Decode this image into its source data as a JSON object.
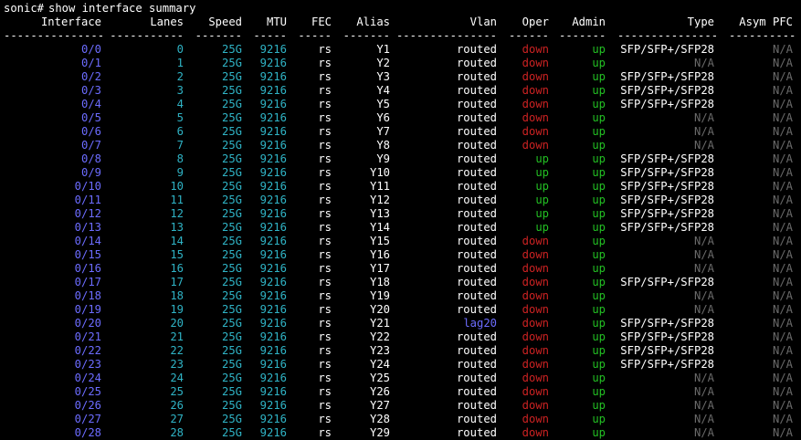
{
  "terminal": {
    "top_line": "---------",
    "prompt": "sonic#",
    "command": "show interface summary"
  },
  "table": {
    "headers": [
      "Interface",
      "Lanes",
      "Speed",
      "MTU",
      "FEC",
      "Alias",
      "Vlan",
      "Oper",
      "Admin",
      "Type",
      "Asym PFC"
    ],
    "dashes": [
      "---------------",
      "-----------",
      "-------",
      "-----",
      "-----",
      "-------",
      "---------------",
      "------",
      "-------",
      "---------------",
      "----------"
    ],
    "rows": [
      {
        "iface": "0/0",
        "lanes": "0",
        "speed": "25G",
        "mtu": "9216",
        "fec": "rs",
        "alias": "Y1",
        "vlan": "routed",
        "oper": "down",
        "admin": "up",
        "type": "SFP/SFP+/SFP28",
        "pfc": "N/A"
      },
      {
        "iface": "0/1",
        "lanes": "1",
        "speed": "25G",
        "mtu": "9216",
        "fec": "rs",
        "alias": "Y2",
        "vlan": "routed",
        "oper": "down",
        "admin": "up",
        "type": "N/A",
        "pfc": "N/A"
      },
      {
        "iface": "0/2",
        "lanes": "2",
        "speed": "25G",
        "mtu": "9216",
        "fec": "rs",
        "alias": "Y3",
        "vlan": "routed",
        "oper": "down",
        "admin": "up",
        "type": "SFP/SFP+/SFP28",
        "pfc": "N/A"
      },
      {
        "iface": "0/3",
        "lanes": "3",
        "speed": "25G",
        "mtu": "9216",
        "fec": "rs",
        "alias": "Y4",
        "vlan": "routed",
        "oper": "down",
        "admin": "up",
        "type": "SFP/SFP+/SFP28",
        "pfc": "N/A"
      },
      {
        "iface": "0/4",
        "lanes": "4",
        "speed": "25G",
        "mtu": "9216",
        "fec": "rs",
        "alias": "Y5",
        "vlan": "routed",
        "oper": "down",
        "admin": "up",
        "type": "SFP/SFP+/SFP28",
        "pfc": "N/A"
      },
      {
        "iface": "0/5",
        "lanes": "5",
        "speed": "25G",
        "mtu": "9216",
        "fec": "rs",
        "alias": "Y6",
        "vlan": "routed",
        "oper": "down",
        "admin": "up",
        "type": "N/A",
        "pfc": "N/A"
      },
      {
        "iface": "0/6",
        "lanes": "6",
        "speed": "25G",
        "mtu": "9216",
        "fec": "rs",
        "alias": "Y7",
        "vlan": "routed",
        "oper": "down",
        "admin": "up",
        "type": "N/A",
        "pfc": "N/A"
      },
      {
        "iface": "0/7",
        "lanes": "7",
        "speed": "25G",
        "mtu": "9216",
        "fec": "rs",
        "alias": "Y8",
        "vlan": "routed",
        "oper": "down",
        "admin": "up",
        "type": "N/A",
        "pfc": "N/A"
      },
      {
        "iface": "0/8",
        "lanes": "8",
        "speed": "25G",
        "mtu": "9216",
        "fec": "rs",
        "alias": "Y9",
        "vlan": "routed",
        "oper": "up",
        "admin": "up",
        "type": "SFP/SFP+/SFP28",
        "pfc": "N/A"
      },
      {
        "iface": "0/9",
        "lanes": "9",
        "speed": "25G",
        "mtu": "9216",
        "fec": "rs",
        "alias": "Y10",
        "vlan": "routed",
        "oper": "up",
        "admin": "up",
        "type": "SFP/SFP+/SFP28",
        "pfc": "N/A"
      },
      {
        "iface": "0/10",
        "lanes": "10",
        "speed": "25G",
        "mtu": "9216",
        "fec": "rs",
        "alias": "Y11",
        "vlan": "routed",
        "oper": "up",
        "admin": "up",
        "type": "SFP/SFP+/SFP28",
        "pfc": "N/A"
      },
      {
        "iface": "0/11",
        "lanes": "11",
        "speed": "25G",
        "mtu": "9216",
        "fec": "rs",
        "alias": "Y12",
        "vlan": "routed",
        "oper": "up",
        "admin": "up",
        "type": "SFP/SFP+/SFP28",
        "pfc": "N/A"
      },
      {
        "iface": "0/12",
        "lanes": "12",
        "speed": "25G",
        "mtu": "9216",
        "fec": "rs",
        "alias": "Y13",
        "vlan": "routed",
        "oper": "up",
        "admin": "up",
        "type": "SFP/SFP+/SFP28",
        "pfc": "N/A"
      },
      {
        "iface": "0/13",
        "lanes": "13",
        "speed": "25G",
        "mtu": "9216",
        "fec": "rs",
        "alias": "Y14",
        "vlan": "routed",
        "oper": "up",
        "admin": "up",
        "type": "SFP/SFP+/SFP28",
        "pfc": "N/A"
      },
      {
        "iface": "0/14",
        "lanes": "14",
        "speed": "25G",
        "mtu": "9216",
        "fec": "rs",
        "alias": "Y15",
        "vlan": "routed",
        "oper": "down",
        "admin": "up",
        "type": "N/A",
        "pfc": "N/A"
      },
      {
        "iface": "0/15",
        "lanes": "15",
        "speed": "25G",
        "mtu": "9216",
        "fec": "rs",
        "alias": "Y16",
        "vlan": "routed",
        "oper": "down",
        "admin": "up",
        "type": "N/A",
        "pfc": "N/A"
      },
      {
        "iface": "0/16",
        "lanes": "16",
        "speed": "25G",
        "mtu": "9216",
        "fec": "rs",
        "alias": "Y17",
        "vlan": "routed",
        "oper": "down",
        "admin": "up",
        "type": "N/A",
        "pfc": "N/A"
      },
      {
        "iface": "0/17",
        "lanes": "17",
        "speed": "25G",
        "mtu": "9216",
        "fec": "rs",
        "alias": "Y18",
        "vlan": "routed",
        "oper": "down",
        "admin": "up",
        "type": "SFP/SFP+/SFP28",
        "pfc": "N/A"
      },
      {
        "iface": "0/18",
        "lanes": "18",
        "speed": "25G",
        "mtu": "9216",
        "fec": "rs",
        "alias": "Y19",
        "vlan": "routed",
        "oper": "down",
        "admin": "up",
        "type": "N/A",
        "pfc": "N/A"
      },
      {
        "iface": "0/19",
        "lanes": "19",
        "speed": "25G",
        "mtu": "9216",
        "fec": "rs",
        "alias": "Y20",
        "vlan": "routed",
        "oper": "down",
        "admin": "up",
        "type": "N/A",
        "pfc": "N/A"
      },
      {
        "iface": "0/20",
        "lanes": "20",
        "speed": "25G",
        "mtu": "9216",
        "fec": "rs",
        "alias": "Y21",
        "vlan": "lag20",
        "oper": "down",
        "admin": "up",
        "type": "SFP/SFP+/SFP28",
        "pfc": "N/A"
      },
      {
        "iface": "0/21",
        "lanes": "21",
        "speed": "25G",
        "mtu": "9216",
        "fec": "rs",
        "alias": "Y22",
        "vlan": "routed",
        "oper": "down",
        "admin": "up",
        "type": "SFP/SFP+/SFP28",
        "pfc": "N/A"
      },
      {
        "iface": "0/22",
        "lanes": "22",
        "speed": "25G",
        "mtu": "9216",
        "fec": "rs",
        "alias": "Y23",
        "vlan": "routed",
        "oper": "down",
        "admin": "up",
        "type": "SFP/SFP+/SFP28",
        "pfc": "N/A"
      },
      {
        "iface": "0/23",
        "lanes": "23",
        "speed": "25G",
        "mtu": "9216",
        "fec": "rs",
        "alias": "Y24",
        "vlan": "routed",
        "oper": "down",
        "admin": "up",
        "type": "SFP/SFP+/SFP28",
        "pfc": "N/A"
      },
      {
        "iface": "0/24",
        "lanes": "24",
        "speed": "25G",
        "mtu": "9216",
        "fec": "rs",
        "alias": "Y25",
        "vlan": "routed",
        "oper": "down",
        "admin": "up",
        "type": "N/A",
        "pfc": "N/A"
      },
      {
        "iface": "0/25",
        "lanes": "25",
        "speed": "25G",
        "mtu": "9216",
        "fec": "rs",
        "alias": "Y26",
        "vlan": "routed",
        "oper": "down",
        "admin": "up",
        "type": "N/A",
        "pfc": "N/A"
      },
      {
        "iface": "0/26",
        "lanes": "26",
        "speed": "25G",
        "mtu": "9216",
        "fec": "rs",
        "alias": "Y27",
        "vlan": "routed",
        "oper": "down",
        "admin": "up",
        "type": "N/A",
        "pfc": "N/A"
      },
      {
        "iface": "0/27",
        "lanes": "27",
        "speed": "25G",
        "mtu": "9216",
        "fec": "rs",
        "alias": "Y28",
        "vlan": "routed",
        "oper": "down",
        "admin": "up",
        "type": "N/A",
        "pfc": "N/A"
      },
      {
        "iface": "0/28",
        "lanes": "28",
        "speed": "25G",
        "mtu": "9216",
        "fec": "rs",
        "alias": "Y29",
        "vlan": "routed",
        "oper": "down",
        "admin": "up",
        "type": "N/A",
        "pfc": "N/A"
      }
    ]
  },
  "colors": {
    "background": "#000000",
    "text": "#ffffff",
    "interface": "#6c6cff",
    "numeric": "#2fb3c5",
    "status_down": "#cc2222",
    "status_up": "#23c023",
    "na": "#6a6a6a"
  }
}
